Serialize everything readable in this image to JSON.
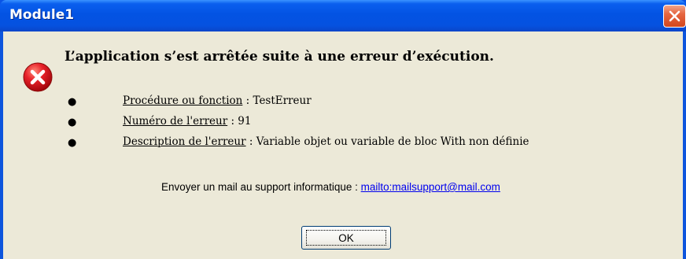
{
  "window": {
    "title": "Module1",
    "close_icon": "close-icon"
  },
  "dialog": {
    "icon": "error-icon",
    "heading": "L’application s’est arrêtée suite à une erreur d’exécution.",
    "items": [
      {
        "label": "Procédure ou fonction",
        "separator": " : ",
        "value": "TestErreur"
      },
      {
        "label": "Numéro de l'erreur",
        "separator": " : ",
        "value": "91"
      },
      {
        "label": "Description de l'erreur",
        "separator": " : ",
        "value": "Variable objet ou variable de bloc With non définie"
      }
    ],
    "support_text": "Envoyer un mail au support informatique : ",
    "support_link": "mailto:mailsupport@mail.com",
    "ok_label": "OK"
  },
  "colors": {
    "titlebar": "#0553e3",
    "dialog_bg": "#ece9d8",
    "close_button": "#e2572f",
    "link": "#0000ee",
    "error_icon": "#d8111b"
  }
}
